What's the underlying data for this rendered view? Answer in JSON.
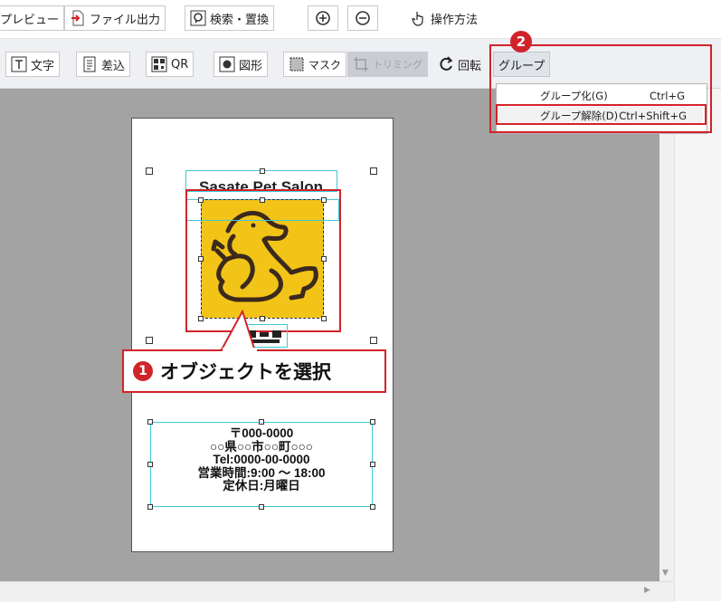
{
  "toolbar_top": {
    "preview_label": "プレビュー",
    "file_output_label": "ファイル出力",
    "search_replace_label": "検索・置換",
    "help_label": "操作方法"
  },
  "toolbar_second": {
    "text_label": "文字",
    "merge_label": "差込",
    "qr_label": "QR",
    "shape_label": "図形",
    "mask_label": "マスク",
    "trimming_label": "トリミング",
    "rotate_label": "回転",
    "group_label": "グループ"
  },
  "group_menu": {
    "items": [
      {
        "label": "グループ化(G)",
        "shortcut": "Ctrl+G"
      },
      {
        "label": "グループ解除(D)",
        "shortcut": "Ctrl+Shift+G"
      }
    ]
  },
  "canvas": {
    "salon_title": "Sasate Pet Salon",
    "address_lines": [
      "〒000-0000",
      "○○県○○市○○町○○○",
      "Tel:0000-00-0000",
      "営業時間:9:00 〜 18:00",
      "定休日:月曜日"
    ]
  },
  "annotations": {
    "step1_number": "1",
    "step1_text": "オブジェクトを選択",
    "step2_number": "2"
  },
  "colors": {
    "accent_red": "#d2232a",
    "selection_cyan": "#3fc9d6",
    "logo_yellow": "#f3c418",
    "canvas_gray": "#a3a3a3"
  }
}
